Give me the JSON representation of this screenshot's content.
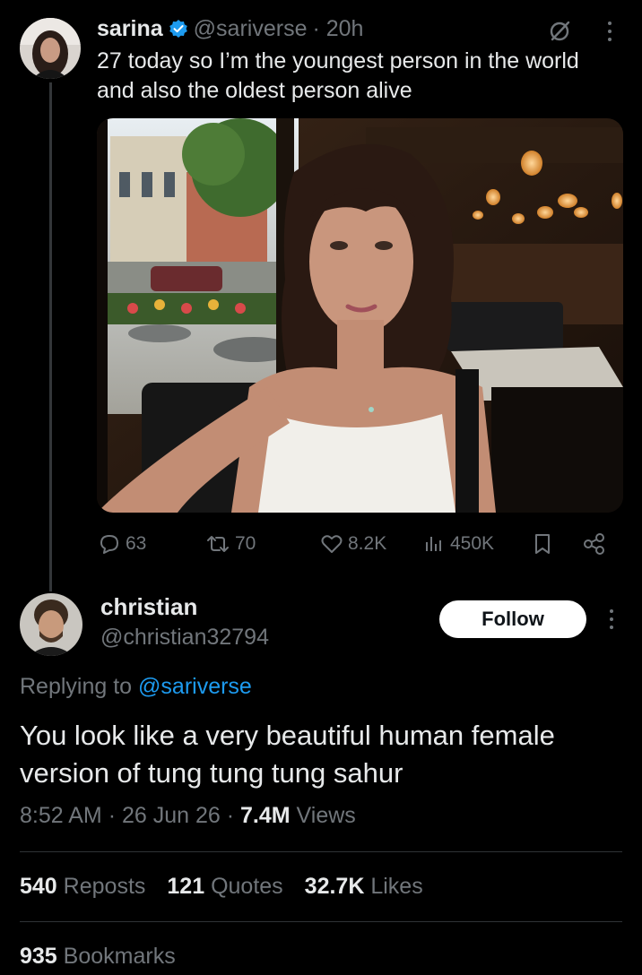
{
  "original_tweet": {
    "display_name": "sarina",
    "handle": "@sariverse",
    "time": "· 20h",
    "text": "27 today so I’m the youngest person in the world and also the oldest person alive",
    "stats": {
      "replies": "63",
      "reposts": "70",
      "likes": "8.2K",
      "views": "450K"
    }
  },
  "reply": {
    "display_name": "christian",
    "handle": "@christian32794",
    "follow_label": "Follow",
    "replying_prefix": "Replying to",
    "replying_to": "@sariverse",
    "text": "You look like a very beautiful human female version of tung tung tung sahur",
    "time": "8:52 AM",
    "date": "· 26 Jun 26 ·",
    "views_count": "7.4M",
    "views_label": "Views",
    "reposts_count": "540",
    "reposts_label": "Reposts",
    "quotes_count": "121",
    "quotes_label": "Quotes",
    "likes_count": "32.7K",
    "likes_label": "Likes",
    "bookmarks_count": "935",
    "bookmarks_label": "Bookmarks"
  },
  "colors": {
    "background": "#000000",
    "text": "#e7e9ea",
    "muted": "#71767b",
    "accent": "#1d9bf0",
    "divider": "#2f3336"
  }
}
